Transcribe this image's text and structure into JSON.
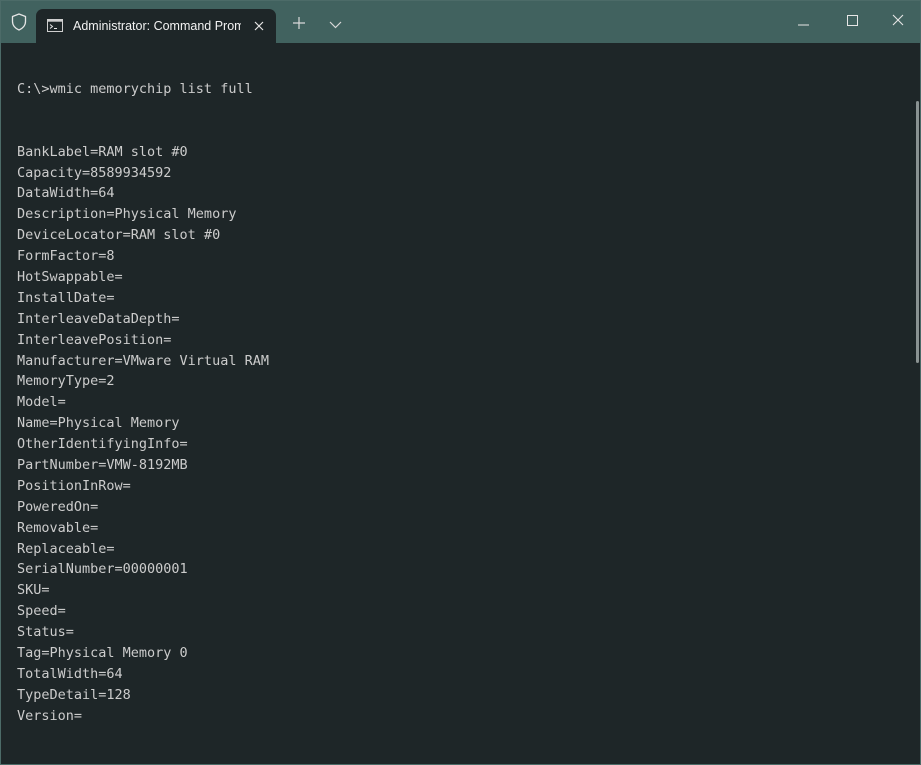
{
  "window": {
    "tab_title": "Administrator: Command Prompt",
    "accent": "#41625f",
    "background": "#1e2628",
    "text_color": "#cccccc"
  },
  "icons": {
    "shield": "shield-icon",
    "tab": "cmd-icon",
    "close_tab": "close-icon",
    "new_tab": "plus-icon",
    "dropdown": "chevron-down-icon",
    "minimize": "minimize-icon",
    "maximize": "maximize-icon",
    "close_window": "close-icon"
  },
  "console": {
    "lines": [
      "C:\\>wmic memorychip list full",
      "",
      "",
      "BankLabel=RAM slot #0",
      "Capacity=8589934592",
      "DataWidth=64",
      "Description=Physical Memory",
      "DeviceLocator=RAM slot #0",
      "FormFactor=8",
      "HotSwappable=",
      "InstallDate=",
      "InterleaveDataDepth=",
      "InterleavePosition=",
      "Manufacturer=VMware Virtual RAM",
      "MemoryType=2",
      "Model=",
      "Name=Physical Memory",
      "OtherIdentifyingInfo=",
      "PartNumber=VMW-8192MB",
      "PositionInRow=",
      "PoweredOn=",
      "Removable=",
      "Replaceable=",
      "SerialNumber=00000001",
      "SKU=",
      "Speed=",
      "Status=",
      "Tag=Physical Memory 0",
      "TotalWidth=64",
      "TypeDetail=128",
      "Version="
    ]
  }
}
